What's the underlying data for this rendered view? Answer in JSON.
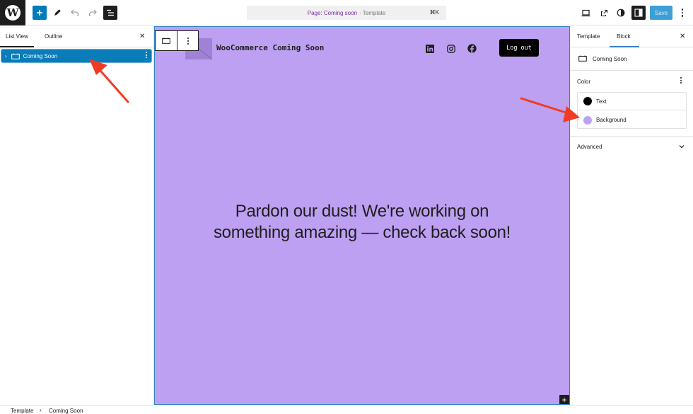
{
  "topbar": {
    "logo_letter": "W",
    "command_page": "Page: Coming soon",
    "command_type": "· Template",
    "command_shortcut": "⌘K",
    "save_label": "Save"
  },
  "left_panel": {
    "tabs": [
      {
        "label": "List View"
      },
      {
        "label": "Outline"
      }
    ],
    "close_glyph": "✕",
    "list_items": [
      {
        "label": "Coming Soon",
        "expand_glyph": "›"
      }
    ]
  },
  "canvas": {
    "site_title": "WooCommerce Coming Soon",
    "logout_label": "Log out",
    "headline_line1": "Pardon our dust! We're working on",
    "headline_line2": "something amazing — check back soon!",
    "background_color": "#bda0f2",
    "inserter_glyph": "+"
  },
  "right_panel": {
    "tabs": [
      {
        "label": "Template"
      },
      {
        "label": "Block"
      }
    ],
    "close_glyph": "✕",
    "block_name": "Coming Soon",
    "color_section_title": "Color",
    "color_items": [
      {
        "label": "Text",
        "swatch": "#000000"
      },
      {
        "label": "Background",
        "swatch": "#bda0f2"
      }
    ],
    "advanced_label": "Advanced"
  },
  "footer": {
    "breadcrumbs": [
      "Template",
      "Coming Soon"
    ],
    "separator": "›"
  },
  "colors": {
    "accent": "#007cba",
    "annotation_arrow": "#f03c24"
  }
}
